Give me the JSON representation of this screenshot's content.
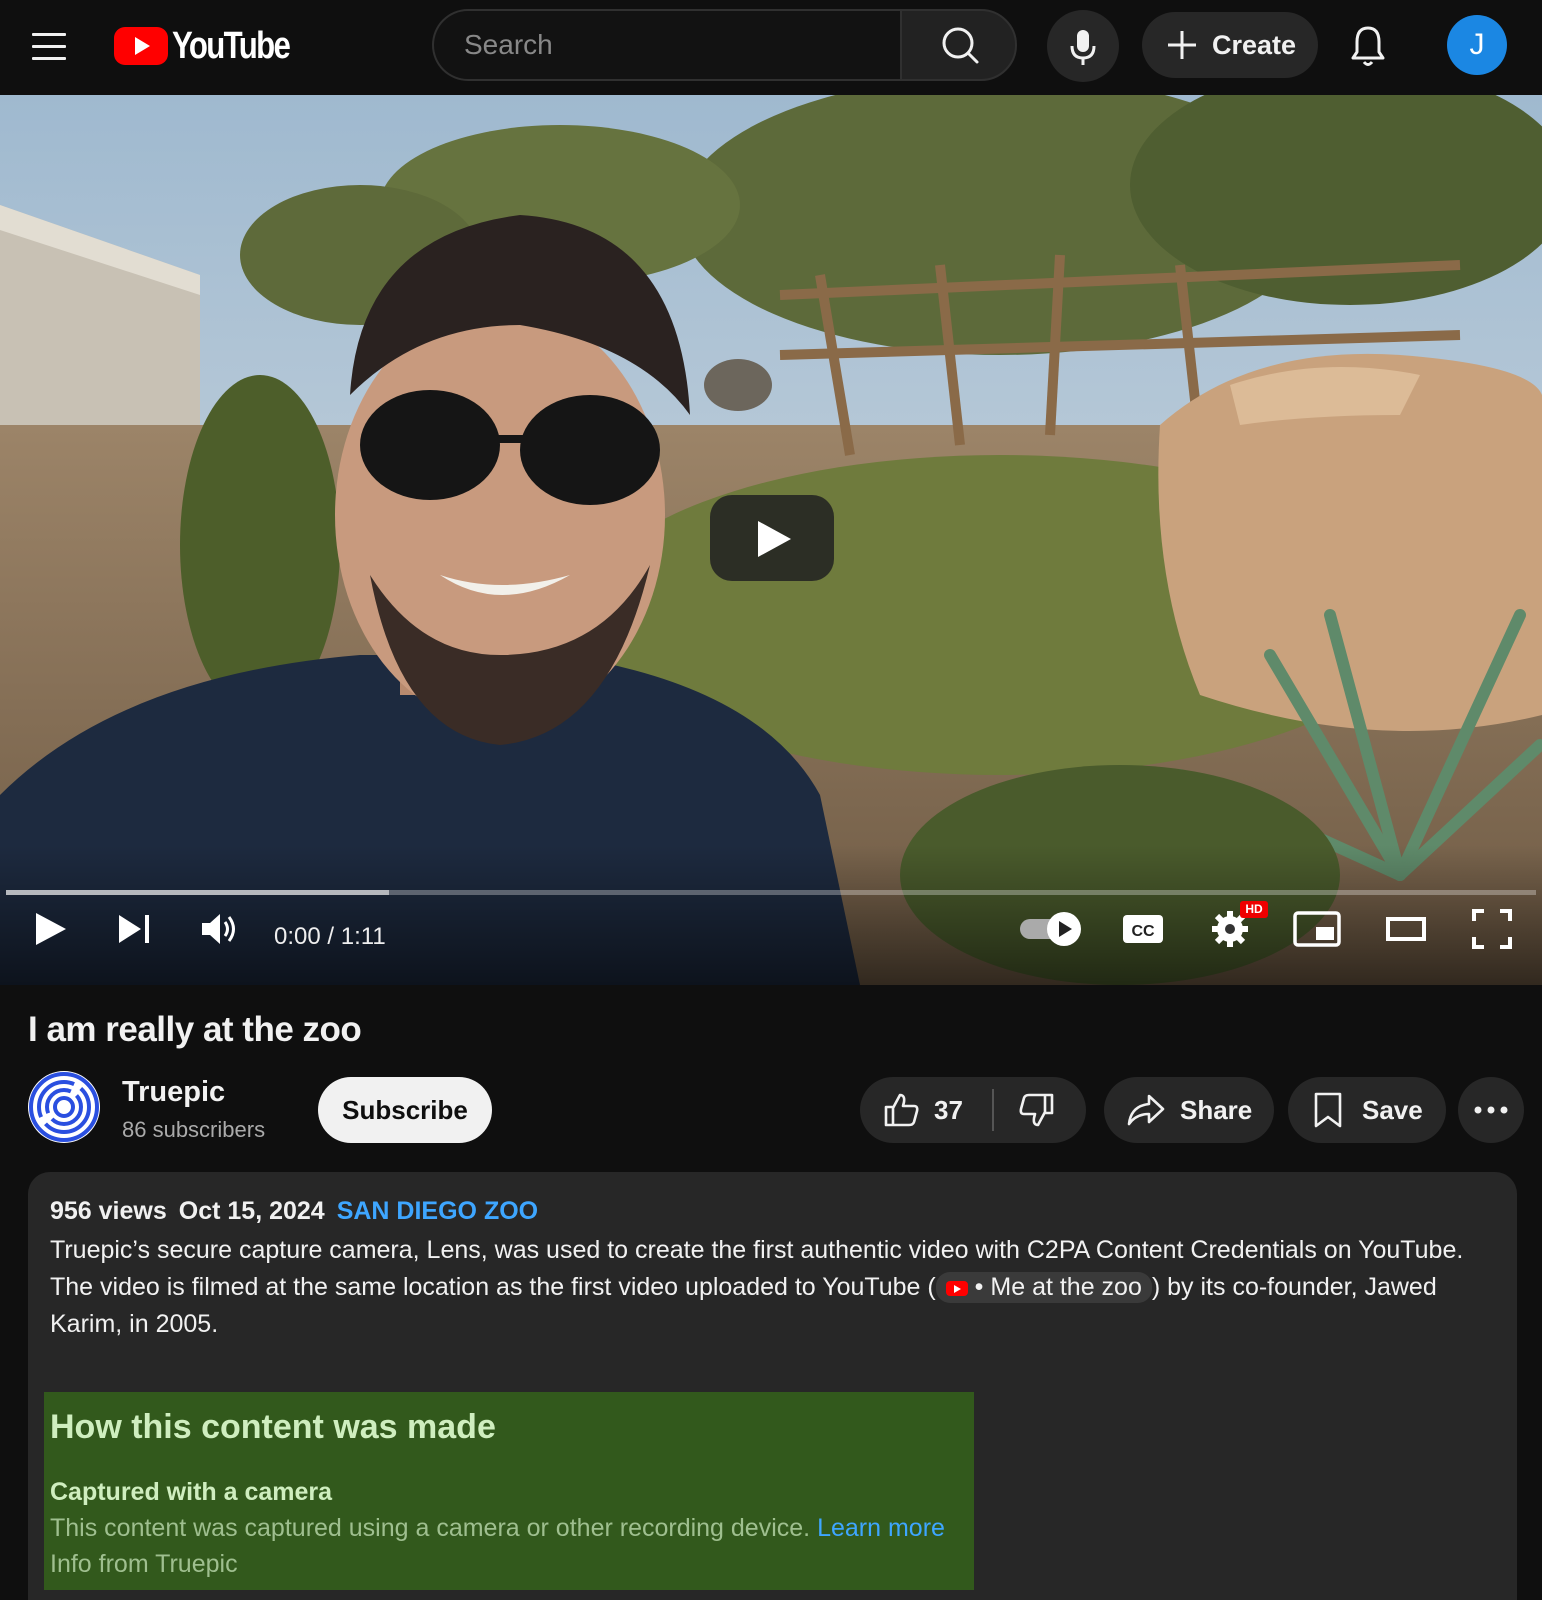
{
  "header": {
    "logo_text": "YouTube",
    "search_placeholder": "Search",
    "create_label": "Create",
    "avatar_letter": "J",
    "avatar_color": "#1b87e3"
  },
  "player": {
    "time_current": "0:00",
    "time_separator": "/",
    "time_total": "1:11",
    "buffered_fraction": 0.25,
    "hd_badge": "HD"
  },
  "video": {
    "title": "I am really at the zoo"
  },
  "channel": {
    "name": "Truepic",
    "subscribers": "86 subscribers",
    "subscribe_label": "Subscribe"
  },
  "actions": {
    "like_count": "37",
    "share_label": "Share",
    "save_label": "Save"
  },
  "description": {
    "views": "956 views",
    "date": "Oct 15, 2024",
    "location_tag": "SAN DIEGO ZOO",
    "line1": "Truepic’s secure capture camera, Lens, was used to create the first authentic video with C2PA Content Credentials on YouTube.",
    "line2_before": "The video is filmed at the same location as the first video uploaded to YouTube (",
    "chip_dot": "•",
    "chip_label": "Me at the zoo",
    "line2_after": ") by its co-founder, Jawed Karim, in 2005."
  },
  "provenance": {
    "title": "How this content was made",
    "subtitle": "Captured with a camera",
    "text": "This content was captured using a camera or other recording device.",
    "link": "Learn more",
    "info": "Info from Truepic"
  },
  "colors": {
    "background": "#0f0f0f",
    "accent_red": "#ff0000",
    "link_blue": "#3ea6ff",
    "provenance_bg": "#32591c"
  }
}
